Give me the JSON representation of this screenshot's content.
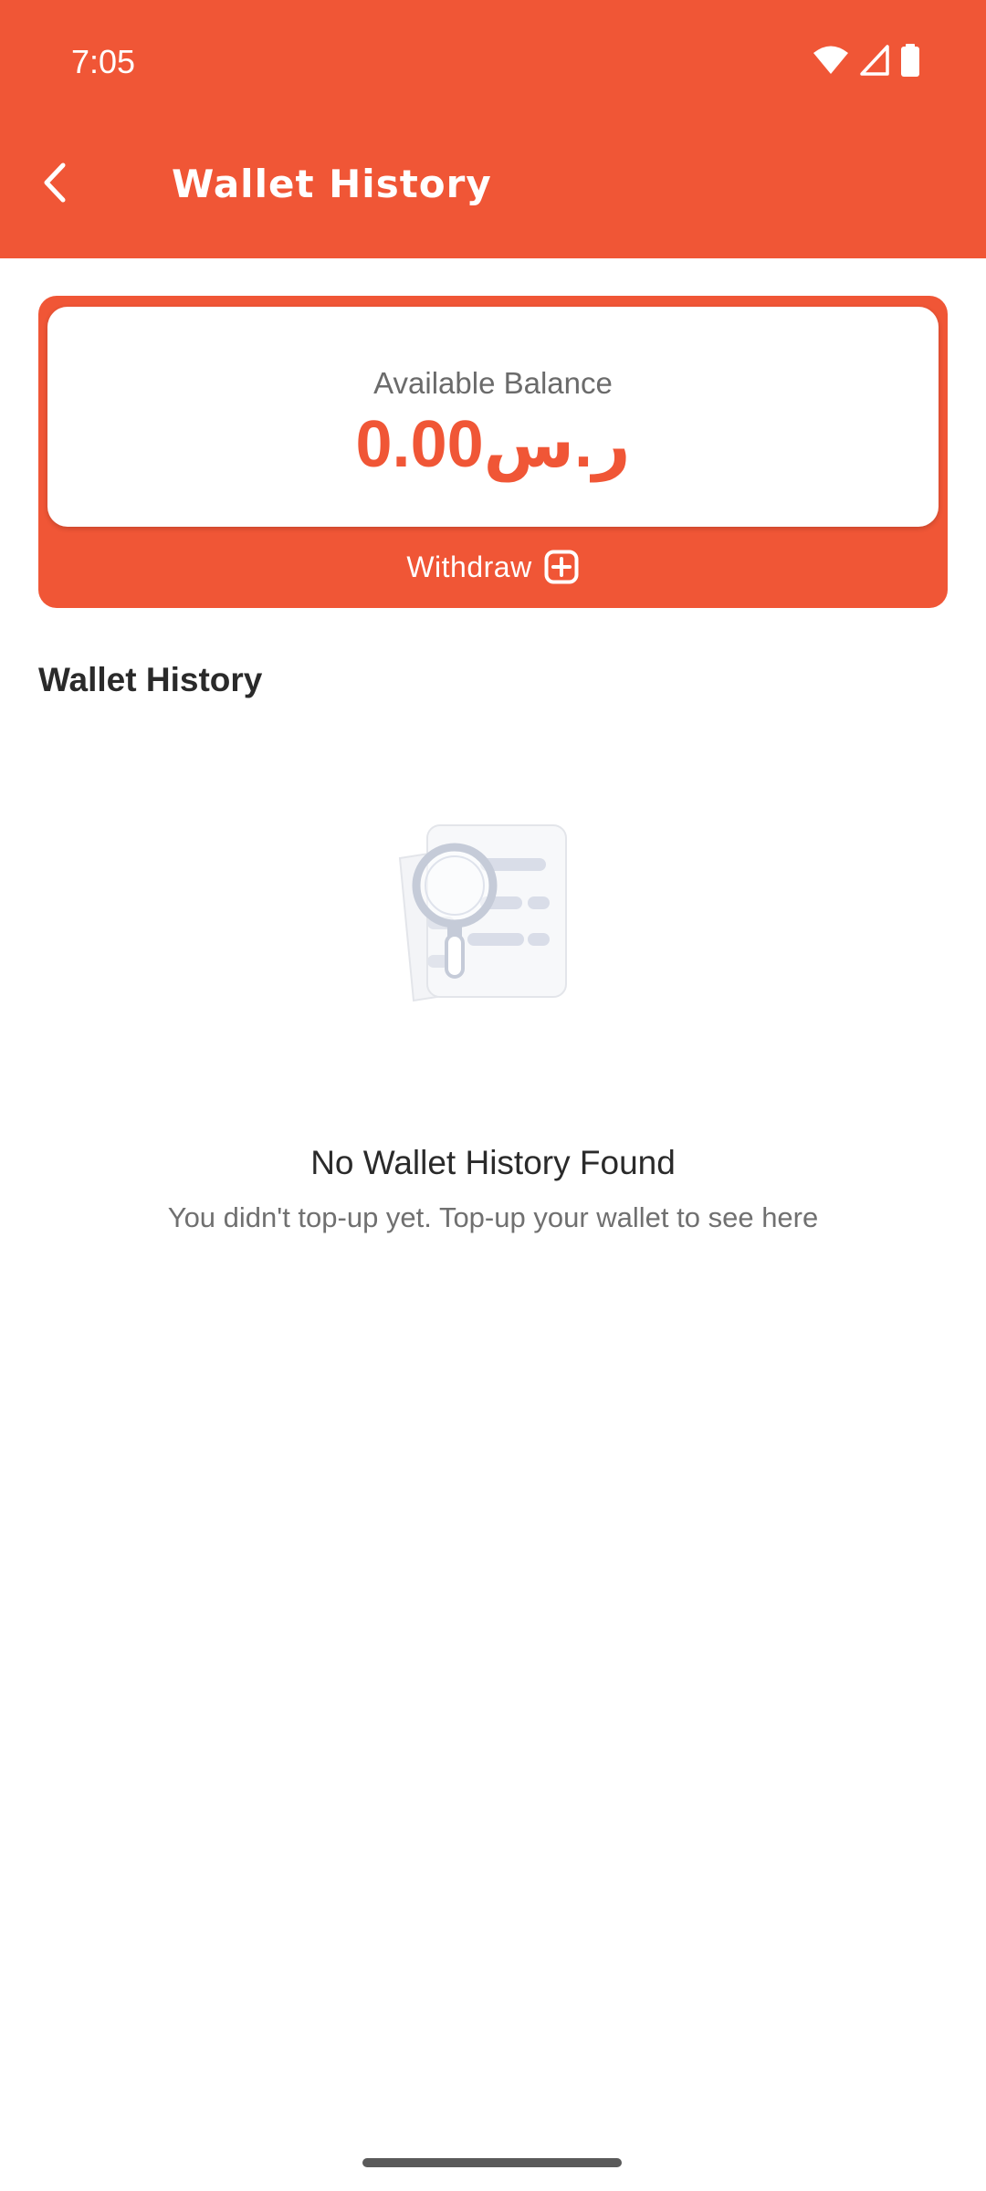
{
  "status_bar": {
    "time": "7:05",
    "icons": [
      "wifi-icon",
      "signal-icon",
      "battery-icon"
    ]
  },
  "header": {
    "title": "Wallet History",
    "back_icon": "chevron-left-icon"
  },
  "balance_card": {
    "label": "Available Balance",
    "amount": "0.00ر.س",
    "withdraw_label": "Withdraw",
    "withdraw_icon": "plus-square-icon"
  },
  "history": {
    "section_title": "Wallet History",
    "empty_title": "No Wallet History Found",
    "empty_subtitle": "You didn't top-up yet. Top-up your wallet to see here",
    "empty_icon": "search-document-icon"
  },
  "colors": {
    "accent": "#f05636",
    "text_dark": "#2a2a2a",
    "text_muted": "#707070"
  }
}
